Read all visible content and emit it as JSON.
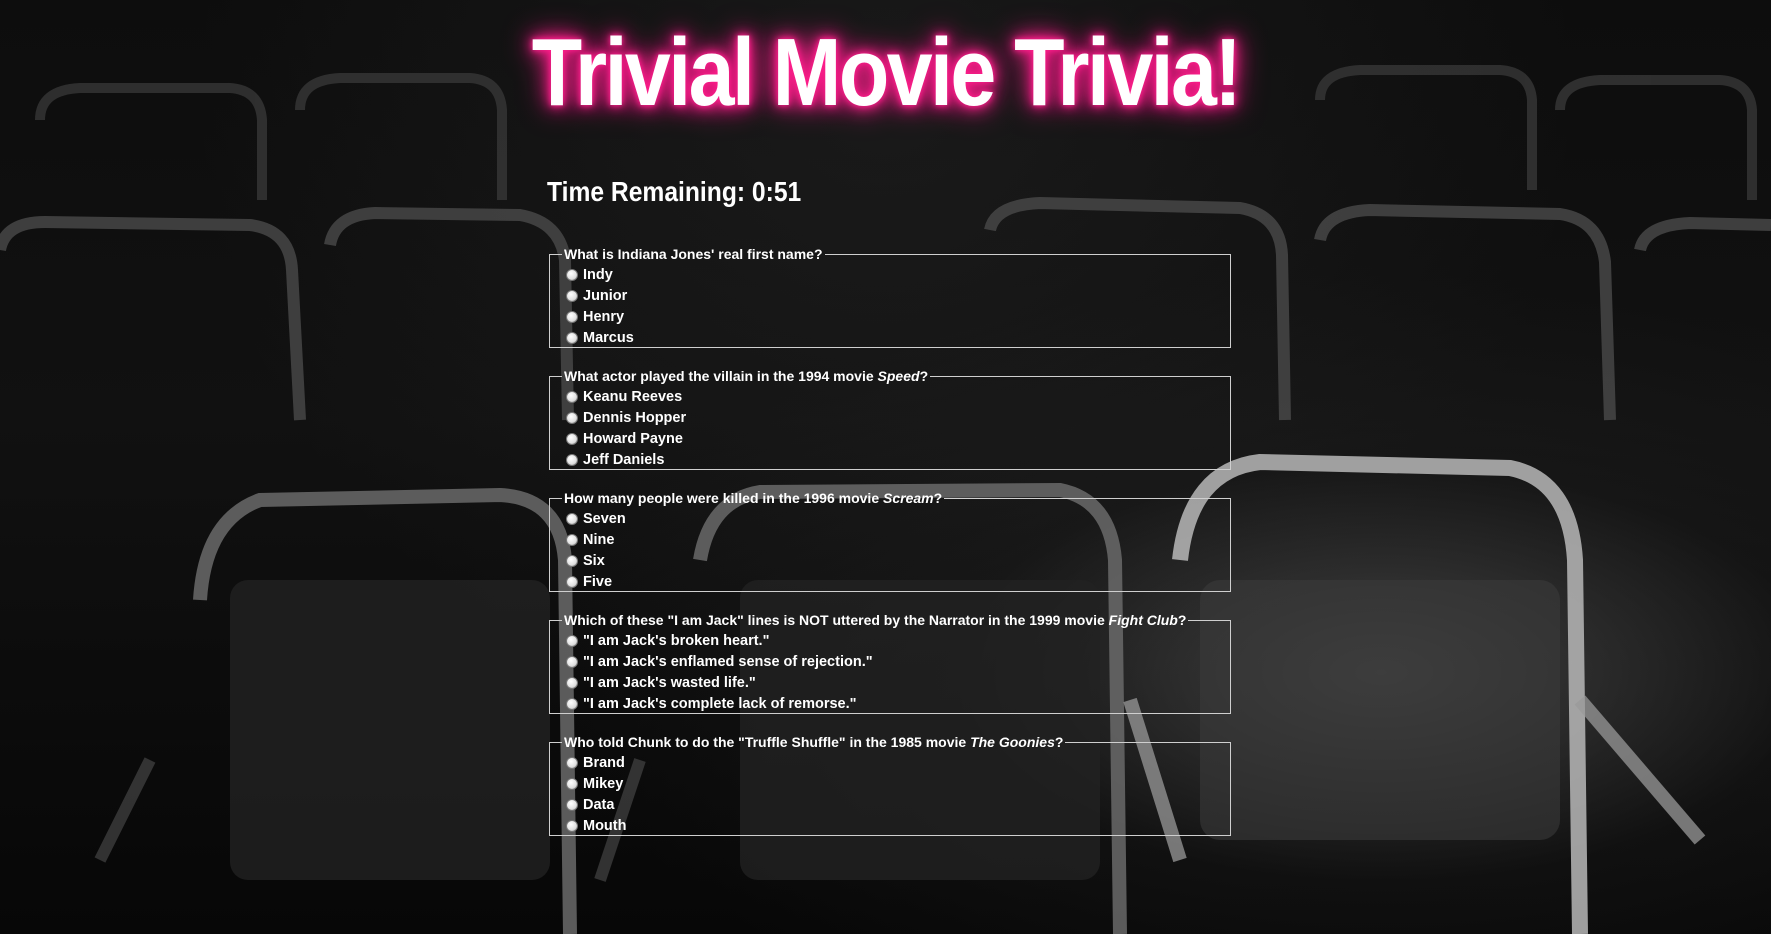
{
  "page": {
    "title": "Trivial Movie Trivia!",
    "timer_text": "Time Remaining: 0:51"
  },
  "colors": {
    "background": "#070707",
    "title_glow": "#ff1e8c",
    "text": "#ffffff",
    "fieldset_border": "#cfcfcf"
  },
  "questions": [
    {
      "text_before": "What is Indiana Jones' real first name?",
      "emph": "",
      "text_after": "",
      "options": [
        "Indy",
        "Junior",
        "Henry",
        "Marcus"
      ]
    },
    {
      "text_before": "What actor played the villain in the 1994 movie ",
      "emph": "Speed",
      "text_after": "?",
      "options": [
        "Keanu Reeves",
        "Dennis Hopper",
        "Howard Payne",
        "Jeff Daniels"
      ]
    },
    {
      "text_before": "How many people were killed in the 1996 movie ",
      "emph": "Scream",
      "text_after": "?",
      "options": [
        "Seven",
        "Nine",
        "Six",
        "Five"
      ]
    },
    {
      "text_before": "Which of these \"I am Jack\" lines is NOT uttered by the Narrator in the 1999 movie ",
      "emph": "Fight Club",
      "text_after": "?",
      "options": [
        "\"I am Jack's broken heart.\"",
        "\"I am Jack's enflamed sense of rejection.\"",
        "\"I am Jack's wasted life.\"",
        "\"I am Jack's complete lack of remorse.\""
      ]
    },
    {
      "text_before": "Who told Chunk to do the \"Truffle Shuffle\" in the 1985 movie ",
      "emph": "The Goonies",
      "text_after": "?",
      "options": [
        "Brand",
        "Mikey",
        "Data",
        "Mouth"
      ]
    }
  ]
}
